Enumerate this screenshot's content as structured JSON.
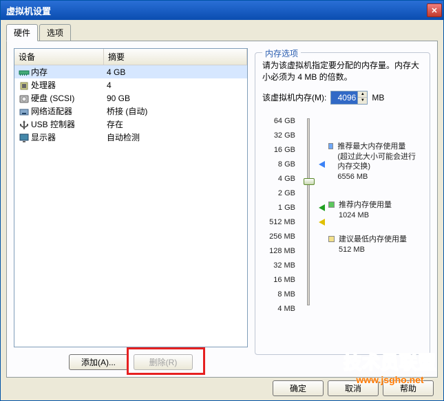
{
  "window": {
    "title": "虚拟机设置"
  },
  "tabs": [
    {
      "label": "硬件",
      "active": true
    },
    {
      "label": "选项",
      "active": false
    }
  ],
  "device_table": {
    "headers": {
      "device": "设备",
      "summary": "摘要"
    },
    "rows": [
      {
        "icon": "memory",
        "name": "内存",
        "summary": "4 GB",
        "selected": true
      },
      {
        "icon": "cpu",
        "name": "处理器",
        "summary": "4"
      },
      {
        "icon": "disk",
        "name": "硬盘 (SCSI)",
        "summary": "90 GB"
      },
      {
        "icon": "nic",
        "name": "网络适配器",
        "summary": "桥接 (自动)"
      },
      {
        "icon": "usb",
        "name": "USB 控制器",
        "summary": "存在"
      },
      {
        "icon": "display",
        "name": "显示器",
        "summary": "自动检测"
      }
    ]
  },
  "buttons": {
    "add": "添加(A)...",
    "remove": "删除(R)",
    "ok": "确定",
    "cancel": "取消",
    "help": "帮助"
  },
  "memory": {
    "group_title": "内存选项",
    "description": "请为该虚拟机指定要分配的内存量。内存大小必须为 4 MB 的倍数。",
    "label": "该虚拟机内存(M):",
    "value": "4096",
    "unit": "MB",
    "ticks": [
      "64 GB",
      "32 GB",
      "16 GB",
      "8 GB",
      "4 GB",
      "2 GB",
      "1 GB",
      "512 MB",
      "256 MB",
      "128 MB",
      "32 MB",
      "16 MB",
      "8 MB",
      "4 MB"
    ],
    "thumb_tick_index": 4,
    "marks": {
      "max": {
        "tick_index": 3
      },
      "rec": {
        "tick_index": 6
      },
      "min": {
        "tick_index": 7
      }
    },
    "recommendations": {
      "max": {
        "title": "推荐最大内存使用量",
        "note": "(超过此大小可能会进行内存交换)",
        "value": "6556 MB"
      },
      "rec": {
        "title": "推荐内存使用量",
        "value": "1024 MB"
      },
      "min": {
        "title": "建议最低内存使用量",
        "value": "512 MB"
      }
    }
  },
  "watermark": {
    "text": "技术员联盟",
    "url": "www.jsgho.net"
  }
}
